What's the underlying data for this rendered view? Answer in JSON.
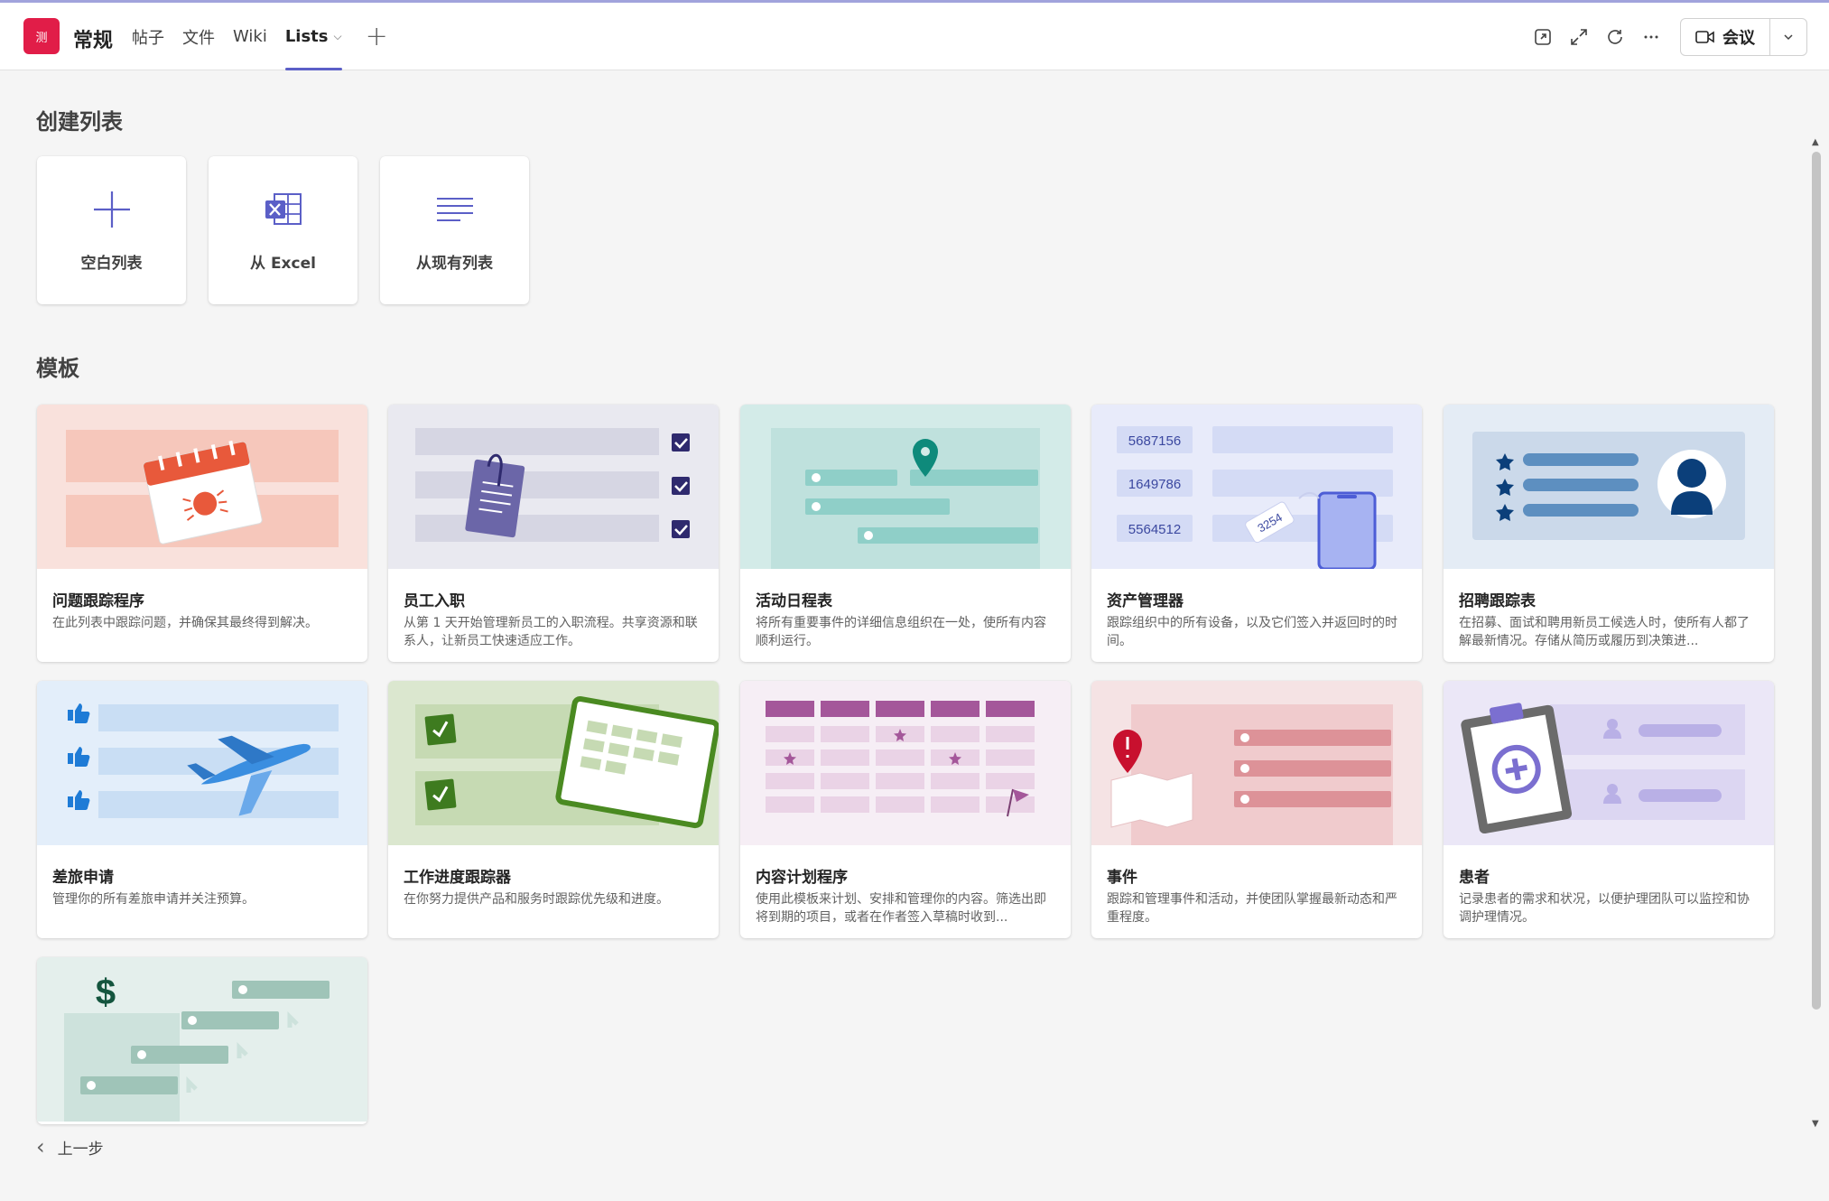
{
  "header": {
    "avatar_text": "测",
    "channel": "常规",
    "tabs": [
      {
        "label": "帖子"
      },
      {
        "label": "文件"
      },
      {
        "label": "Wiki"
      },
      {
        "label": "Lists"
      }
    ],
    "meeting_label": "会议"
  },
  "create": {
    "title": "创建列表",
    "cards": [
      {
        "label": "空白列表",
        "icon": "plus-icon"
      },
      {
        "label": "从 Excel",
        "icon": "excel-icon"
      },
      {
        "label": "从现有列表",
        "icon": "list-lines-icon"
      }
    ]
  },
  "templates": {
    "title": "模板",
    "items": [
      {
        "title": "问题跟踪程序",
        "desc": "在此列表中跟踪问题，并确保其最终得到解决。",
        "art": "issue-tracker"
      },
      {
        "title": "员工入职",
        "desc": "从第 1 天开始管理新员工的入职流程。共享资源和联系人，让新员工快速适应工作。",
        "art": "onboarding"
      },
      {
        "title": "活动日程表",
        "desc": "将所有重要事件的详细信息组织在一处，使所有内容顺利运行。",
        "art": "event-itinerary"
      },
      {
        "title": "资产管理器",
        "desc": "跟踪组织中的所有设备，以及它们签入并返回时的时间。",
        "art": "asset-manager",
        "numbers": [
          "5687156",
          "1649786",
          "5564512"
        ],
        "tag": "3254"
      },
      {
        "title": "招聘跟踪表",
        "desc": "在招募、面试和聘用新员工候选人时，使所有人都了解最新情况。存储从简历或履历到决策进...",
        "art": "recruitment"
      },
      {
        "title": "差旅申请",
        "desc": "管理你的所有差旅申请并关注预算。",
        "art": "travel"
      },
      {
        "title": "工作进度跟踪器",
        "desc": "在你努力提供产品和服务时跟踪优先级和进度。",
        "art": "work-progress"
      },
      {
        "title": "内容计划程序",
        "desc": "使用此模板来计划、安排和管理你的内容。筛选出即将到期的项目，或者在作者签入草稿时收到...",
        "art": "content-scheduler"
      },
      {
        "title": "事件",
        "desc": "跟踪和管理事件和活动，并使团队掌握最新动态和严重程度。",
        "art": "incidents"
      },
      {
        "title": "患者",
        "desc": "记录患者的需求和状况，以便护理团队可以监控和协调护理情况。",
        "art": "patients"
      },
      {
        "title": "",
        "desc": "",
        "art": "loans"
      }
    ]
  },
  "footer": {
    "back_label": "上一步"
  },
  "colors": {
    "accent": "#5b5fc7",
    "avatar": "#e11d48"
  }
}
